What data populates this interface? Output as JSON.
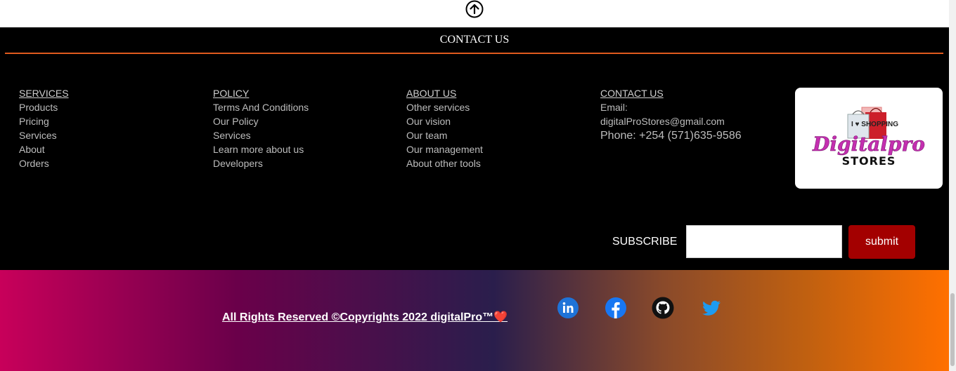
{
  "footer": {
    "title": "CONTACT US",
    "columns": {
      "services": {
        "head": "SERVICES",
        "items": [
          "Products",
          "Pricing",
          "Services",
          "About",
          "Orders"
        ]
      },
      "policy": {
        "head": "POLICY",
        "items": [
          "Terms And Conditions",
          "Our Policy",
          "Services",
          "Learn more about us",
          "Developers"
        ]
      },
      "about": {
        "head": "ABOUT US",
        "items": [
          "Other services",
          "Our vision",
          "Our team",
          "Our management",
          "About other tools"
        ]
      },
      "contact": {
        "head": "CONTACT US",
        "email_label": "Email:",
        "email": "digitalProStores@gmail.com",
        "phone": "Phone: +254 (571)635-9586"
      }
    },
    "logo": {
      "line1": "Digitalpro",
      "line2": "STORES",
      "tag": "I ♥ SHOPPING"
    },
    "subscribe": {
      "label": "SUBSCRIBE",
      "placeholder": "",
      "button": "submit"
    }
  },
  "bottom": {
    "copyright": "All Rights Reserved ©Copyrights 2022 digitalPro™❤️",
    "social": [
      "linkedin-icon",
      "facebook-icon",
      "github-icon",
      "twitter-icon"
    ]
  },
  "colors": {
    "accent_line": "#e05a1e",
    "submit": "#a30000"
  }
}
